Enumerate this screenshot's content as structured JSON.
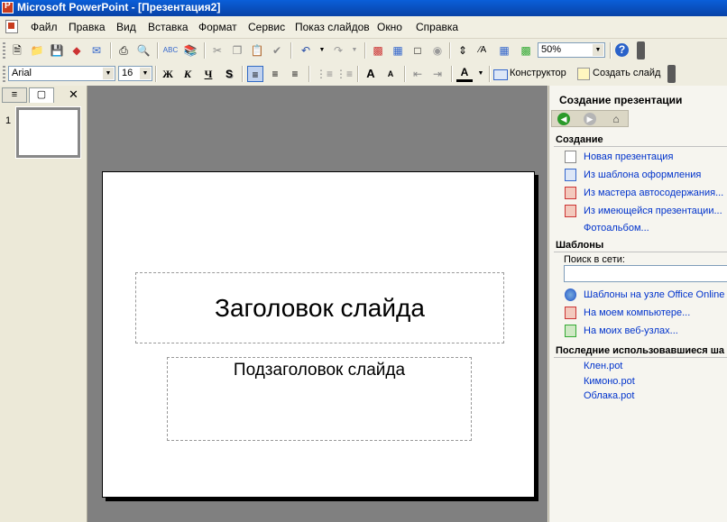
{
  "window": {
    "title": "Microsoft PowerPoint - [Презентация2]"
  },
  "menu": [
    "Файл",
    "Правка",
    "Вид",
    "Вставка",
    "Формат",
    "Сервис",
    "Показ слайдов",
    "Окно",
    "Справка"
  ],
  "toolbar": {
    "zoom": "50%"
  },
  "formatting": {
    "font": "Arial",
    "size": "16",
    "bold": "Ж",
    "italic": "К",
    "underline": "Ч",
    "shadow": "S",
    "font_grow": "A",
    "font_shrink": "A",
    "font_color": "A",
    "designer": "Конструктор",
    "new_slide": "Создать слайд"
  },
  "outline": {
    "slide_number": "1"
  },
  "slide": {
    "title": "Заголовок слайда",
    "subtitle": "Подзаголовок слайда"
  },
  "taskpane": {
    "title": "Создание презентации",
    "create_header": "Создание",
    "create_links": [
      "Новая презентация",
      "Из шаблона оформления",
      "Из мастера автосодержания...",
      "Из имеющейся презентации...",
      "Фотоальбом..."
    ],
    "templates_header": "Шаблоны",
    "search_label": "Поиск в сети:",
    "search_value": "",
    "template_links": [
      "Шаблоны на узле Office Online",
      "На моем компьютере...",
      "На моих веб-узлах..."
    ],
    "recent_header": "Последние использовавшиеся ша",
    "recent_links": [
      "Клен.pot",
      "Кимоно.pot",
      "Облака.pot"
    ]
  },
  "icons": {
    "back": "back-arrow-icon",
    "forward": "forward-arrow-icon",
    "home": "home-icon",
    "help": "help-icon"
  }
}
